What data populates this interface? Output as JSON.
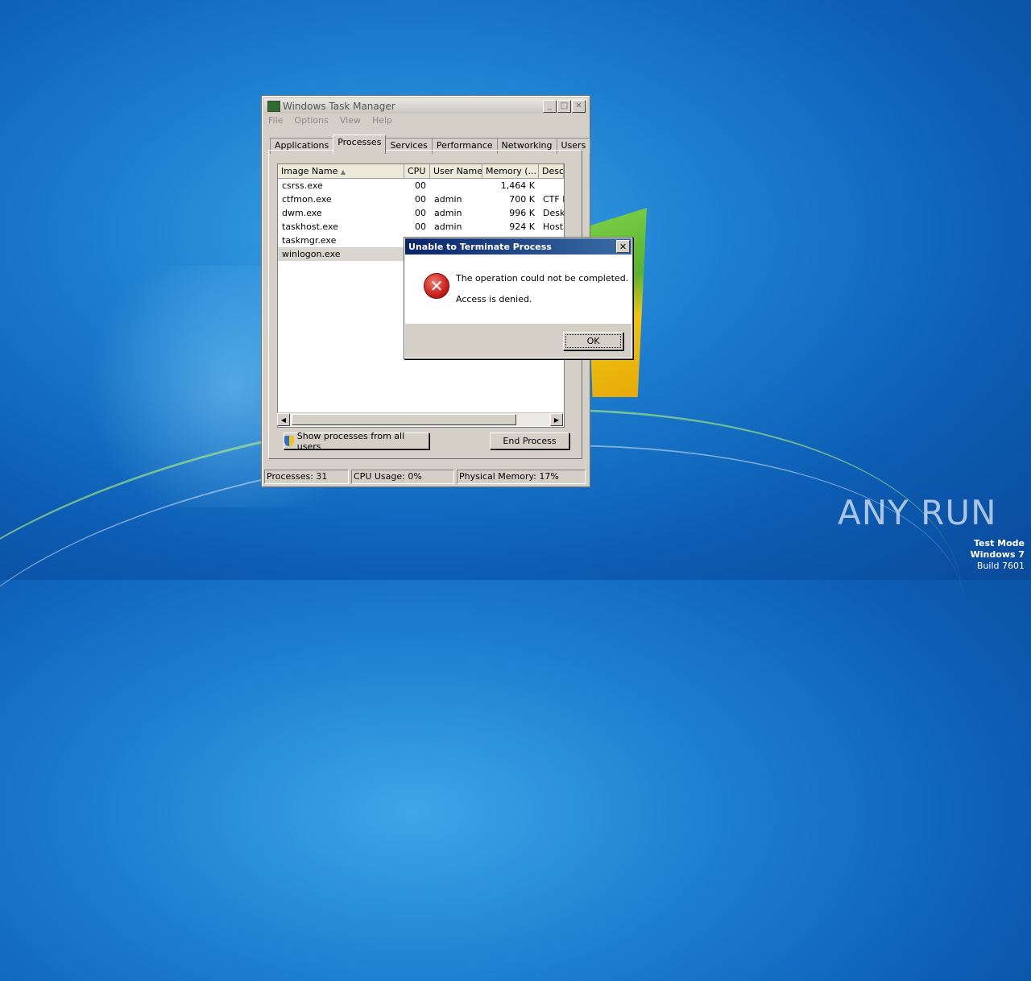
{
  "task_manager": {
    "title": "Windows Task Manager",
    "menu": [
      "File",
      "Options",
      "View",
      "Help"
    ],
    "tabs": [
      "Applications",
      "Processes",
      "Services",
      "Performance",
      "Networking",
      "Users"
    ],
    "active_tab": "Processes",
    "columns": [
      "Image Name",
      "CPU",
      "User Name",
      "Memory (...",
      "Desc"
    ],
    "rows": [
      {
        "name": "csrss.exe",
        "cpu": "00",
        "user": "",
        "mem": "1,464 K",
        "desc": ""
      },
      {
        "name": "ctfmon.exe",
        "cpu": "00",
        "user": "admin",
        "mem": "700 K",
        "desc": "CTF L"
      },
      {
        "name": "dwm.exe",
        "cpu": "00",
        "user": "admin",
        "mem": "996 K",
        "desc": "Desk"
      },
      {
        "name": "taskhost.exe",
        "cpu": "00",
        "user": "admin",
        "mem": "924 K",
        "desc": "Host"
      },
      {
        "name": "taskmgr.exe",
        "cpu": "",
        "user": "",
        "mem": "",
        "desc": ""
      },
      {
        "name": "winlogon.exe",
        "cpu": "",
        "user": "",
        "mem": "",
        "desc": ""
      }
    ],
    "selected_row": 5,
    "show_all_button": "Show processes from all users",
    "end_process_button": "End Process",
    "status": {
      "processes": "Processes: 31",
      "cpu": "CPU Usage: 0%",
      "memory": "Physical Memory: 17%"
    }
  },
  "dialog": {
    "title": "Unable to Terminate Process",
    "close_label": "✕",
    "message_line1": "The operation could not be completed.",
    "message_line2": "Access is denied.",
    "ok_button": "OK",
    "icon": "error-icon"
  },
  "watermark": {
    "brand": "ANY RUN",
    "line1": "Test Mode",
    "line2": "Windows 7",
    "line3": "Build 7601"
  },
  "colors": {
    "dialog_title_bar": "#0a246a",
    "error_red": "#c8211a",
    "desktop_blue": "#1d7fd0"
  }
}
